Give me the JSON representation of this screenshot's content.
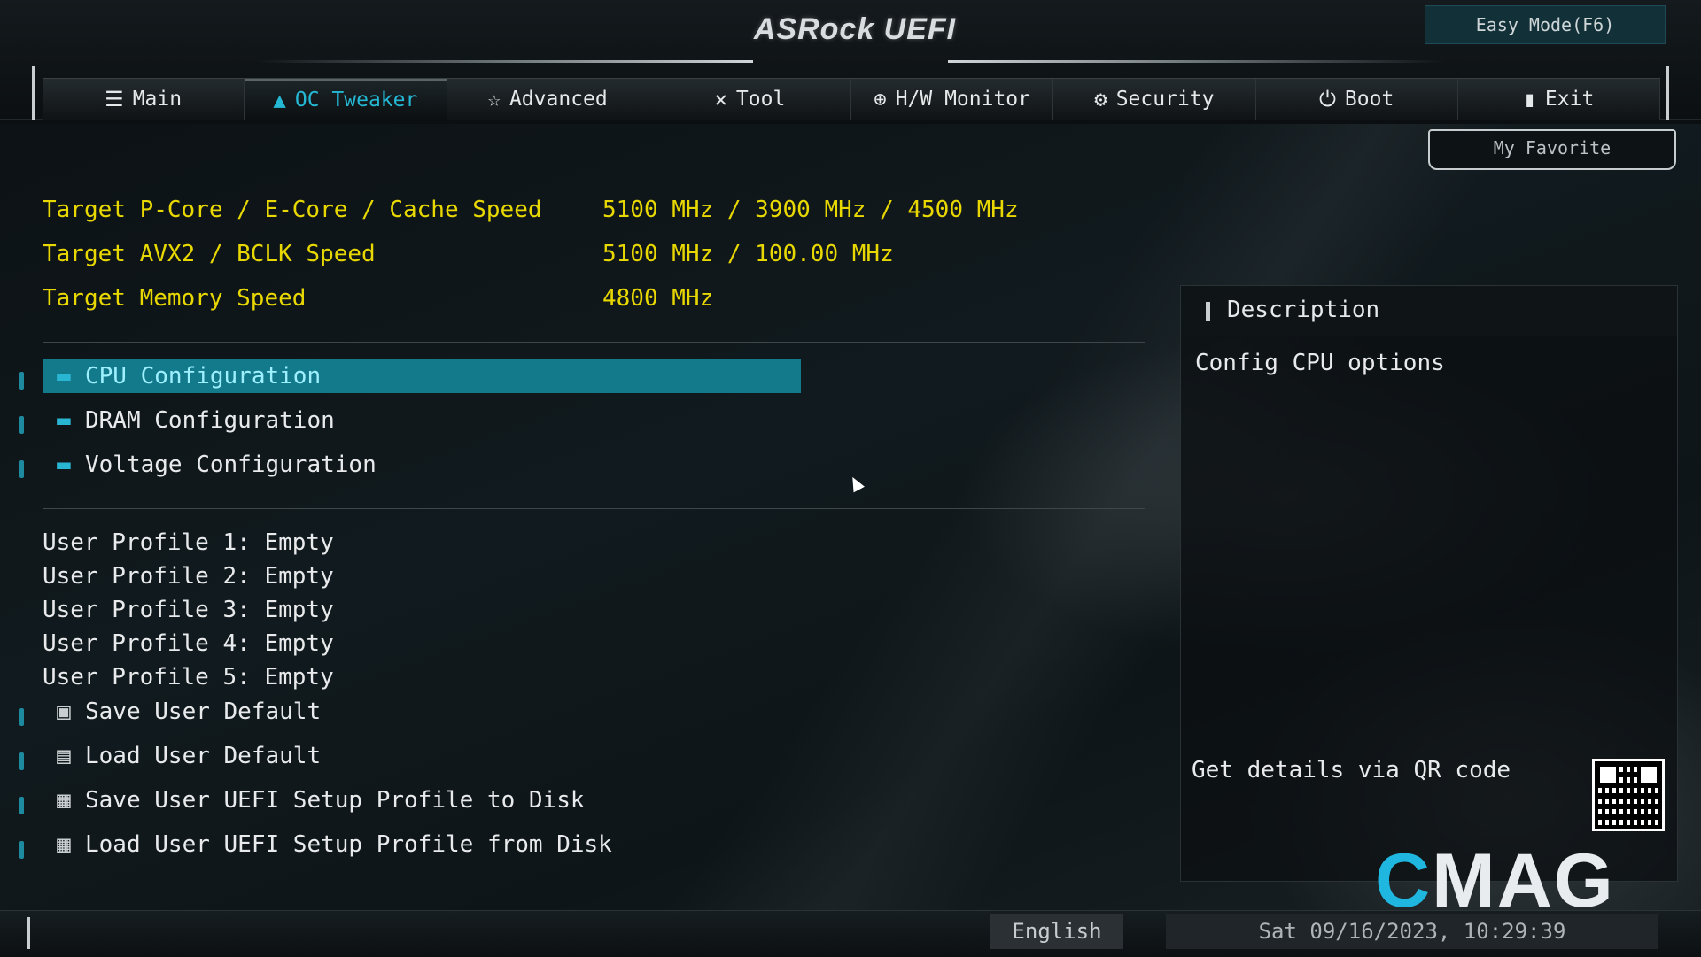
{
  "header": {
    "logo": "ASRock UEFI",
    "easy_mode": "Easy Mode(F6)",
    "my_favorite": "My Favorite"
  },
  "tabs": [
    {
      "label": "Main",
      "icon": "list-icon",
      "active": false
    },
    {
      "label": "OC Tweaker",
      "icon": "rocket-icon",
      "active": true
    },
    {
      "label": "Advanced",
      "icon": "star-icon",
      "active": false
    },
    {
      "label": "Tool",
      "icon": "tools-icon",
      "active": false
    },
    {
      "label": "H/W Monitor",
      "icon": "crosshair-icon",
      "active": false
    },
    {
      "label": "Security",
      "icon": "shield-icon",
      "active": false
    },
    {
      "label": "Boot",
      "icon": "power-icon",
      "active": false
    },
    {
      "label": "Exit",
      "icon": "exit-door-icon",
      "active": false
    }
  ],
  "info": [
    {
      "label": "Target P-Core / E-Core / Cache Speed",
      "value": "5100 MHz / 3900 MHz / 4500 MHz"
    },
    {
      "label": "Target AVX2 / BCLK Speed",
      "value": "5100 MHz / 100.00 MHz"
    },
    {
      "label": "Target Memory Speed",
      "value": "4800 MHz"
    }
  ],
  "config_items": [
    {
      "label": "CPU Configuration",
      "icon": "folder-icon",
      "selected": true
    },
    {
      "label": "DRAM Configuration",
      "icon": "folder-icon",
      "selected": false
    },
    {
      "label": "Voltage Configuration",
      "icon": "folder-icon",
      "selected": false
    }
  ],
  "profiles": [
    "User Profile 1: Empty",
    "User Profile 2: Empty",
    "User Profile 3: Empty",
    "User Profile 4: Empty",
    "User Profile 5: Empty"
  ],
  "actions": [
    {
      "label": "Save User Default",
      "icon": "floppy-icon"
    },
    {
      "label": "Load User Default",
      "icon": "book-icon"
    },
    {
      "label": "Save User UEFI Setup Profile to Disk",
      "icon": "disk-save-icon"
    },
    {
      "label": "Load User UEFI Setup Profile from Disk",
      "icon": "disk-load-icon"
    }
  ],
  "description": {
    "title": "Description",
    "text": "Config CPU options",
    "qr_text": "Get details via QR code"
  },
  "footer": {
    "language": "English",
    "datetime": "Sat 09/16/2023, 10:29:39"
  },
  "watermark": {
    "c": "C",
    "rest": "MAG"
  },
  "colors": {
    "accent": "#25b8d5",
    "info": "#e8d800",
    "selection": "#137a8c"
  }
}
